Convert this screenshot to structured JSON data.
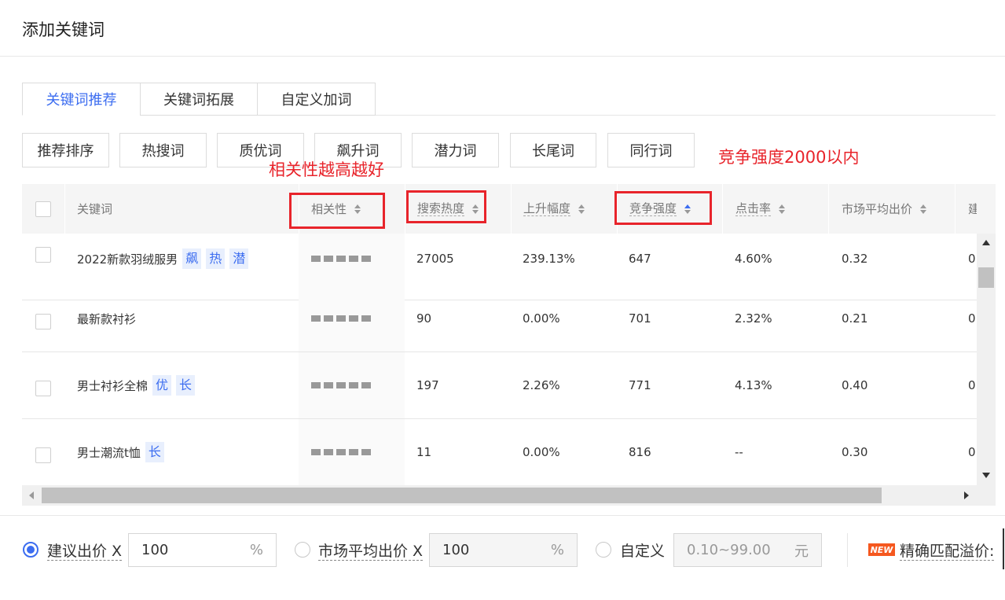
{
  "window": {
    "title": "添加关键词"
  },
  "tabs": [
    {
      "label": "关键词推荐",
      "active": true
    },
    {
      "label": "关键词拓展",
      "active": false
    },
    {
      "label": "自定义加词",
      "active": false
    }
  ],
  "filters": [
    "推荐排序",
    "热搜词",
    "质优词",
    "飙升词",
    "潜力词",
    "长尾词",
    "同行词"
  ],
  "annotations": {
    "relevance_note": "相关性越高越好",
    "competition_note": "竞争强度2000以内"
  },
  "table": {
    "columns": [
      "关键词",
      "相关性",
      "搜索热度",
      "上升幅度",
      "竞争强度",
      "点击率",
      "市场平均出价",
      "建"
    ],
    "rows": [
      {
        "keyword": "2022新款羽绒服男",
        "tags": [
          "飙",
          "热",
          "潜"
        ],
        "search_heat": "27005",
        "rise": "239.13%",
        "competition": "647",
        "ctr": "4.60%",
        "avg_bid": "0.32",
        "next": "0."
      },
      {
        "keyword": "最新款衬衫",
        "tags": [],
        "search_heat": "90",
        "rise": "0.00%",
        "competition": "701",
        "ctr": "2.32%",
        "avg_bid": "0.21",
        "next": "0."
      },
      {
        "keyword": "男士衬衫全棉",
        "tags": [
          "优",
          "长"
        ],
        "search_heat": "197",
        "rise": "2.26%",
        "competition": "771",
        "ctr": "4.13%",
        "avg_bid": "0.40",
        "next": "0."
      },
      {
        "keyword": "男士潮流t恤",
        "tags": [
          "长"
        ],
        "search_heat": "11",
        "rise": "0.00%",
        "competition": "816",
        "ctr": "--",
        "avg_bid": "0.30",
        "next": "0."
      }
    ]
  },
  "bid": {
    "suggested": {
      "label": "建议出价 X",
      "value": "100",
      "unit": "%"
    },
    "market": {
      "label": "市场平均出价 X",
      "value": "100",
      "unit": "%"
    },
    "custom": {
      "label": "自定义",
      "placeholder": "0.10~99.00",
      "unit": "元"
    },
    "new_badge": "NEW",
    "exact_match": "精确匹配溢价:"
  },
  "colors": {
    "accent": "#3c6df0",
    "annotation": "#e8242b",
    "badge": "#f5581f"
  }
}
